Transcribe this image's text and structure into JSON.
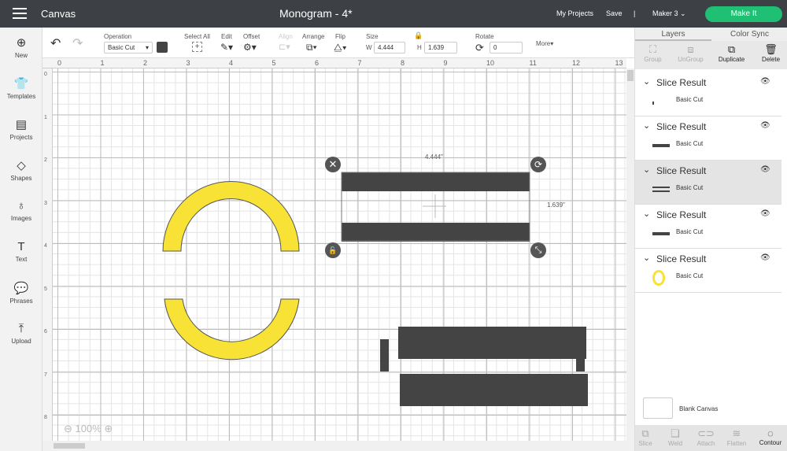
{
  "topbar": {
    "title": "Canvas",
    "doc_title": "Monogram - 4*",
    "my_projects": "My Projects",
    "save": "Save",
    "separator": "|",
    "machine": "Maker 3",
    "make_it": "Make It",
    "accent": "#1fbf74"
  },
  "sidebar": [
    {
      "label": "New",
      "icon": "plus-circle"
    },
    {
      "label": "Templates",
      "icon": "shirt"
    },
    {
      "label": "Projects",
      "icon": "projects"
    },
    {
      "label": "Shapes",
      "icon": "shapes"
    },
    {
      "label": "Images",
      "icon": "lightbulb"
    },
    {
      "label": "Text",
      "icon": "text-T"
    },
    {
      "label": "Phrases",
      "icon": "speech-bubble"
    },
    {
      "label": "Upload",
      "icon": "upload"
    }
  ],
  "toolbar": {
    "operation_label": "Operation",
    "operation_value": "Basic Cut",
    "select_all": "Select All",
    "edit": "Edit",
    "offset": "Offset",
    "align": "Align",
    "arrange": "Arrange",
    "flip": "Flip",
    "size": "Size",
    "w_label": "W",
    "w_value": "4.444",
    "h_label": "H",
    "h_value": "1.639",
    "rotate": "Rotate",
    "rotate_value": "0",
    "more": "More▾",
    "color": "#444444"
  },
  "rulers": {
    "top": [
      "0",
      "1",
      "2",
      "3",
      "4",
      "5",
      "6",
      "7",
      "8",
      "9",
      "10",
      "11",
      "12",
      "13"
    ],
    "left": [
      "0",
      "1",
      "2",
      "3",
      "4",
      "5",
      "6",
      "7",
      "8"
    ]
  },
  "canvas": {
    "width_label": "4.444\"",
    "height_label": "1.639\"",
    "zoom": "100%",
    "shape_yellow": "#f7e235",
    "shape_dark": "#444444"
  },
  "panel": {
    "tabs": [
      "Layers",
      "Color Sync"
    ],
    "tools": [
      {
        "label": "Group",
        "enabled": false
      },
      {
        "label": "UnGroup",
        "enabled": false
      },
      {
        "label": "Duplicate",
        "enabled": true
      },
      {
        "label": "Delete",
        "enabled": true
      }
    ],
    "layers": [
      {
        "name": "Slice Result",
        "sub": "Basic Cut",
        "thumb": "dot"
      },
      {
        "name": "Slice Result",
        "sub": "Basic Cut",
        "thumb": "bar"
      },
      {
        "name": "Slice Result",
        "sub": "Basic Cut",
        "thumb": "double-bar",
        "selected": true
      },
      {
        "name": "Slice Result",
        "sub": "Basic Cut",
        "thumb": "bar"
      },
      {
        "name": "Slice Result",
        "sub": "Basic Cut",
        "thumb": "yellow-ring"
      }
    ],
    "blank_canvas": "Blank Canvas",
    "bottom_tools": [
      {
        "label": "Slice",
        "enabled": false
      },
      {
        "label": "Weld",
        "enabled": false
      },
      {
        "label": "Attach",
        "enabled": false
      },
      {
        "label": "Flatten",
        "enabled": false
      },
      {
        "label": "Contour",
        "enabled": true
      }
    ]
  }
}
